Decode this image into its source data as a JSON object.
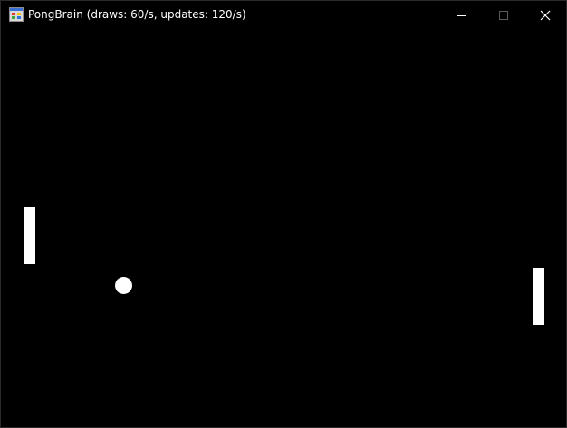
{
  "window": {
    "title": "PongBrain (draws: 60/s, updates: 120/s)",
    "app_icon": "application-icon",
    "controls": {
      "minimize_icon": "minimize-icon",
      "maximize_icon": "maximize-icon",
      "close_icon": "close-icon"
    }
  },
  "colors": {
    "background": "#000000",
    "foreground": "#ffffff",
    "disabled_control": "#5a5a5a"
  },
  "game": {
    "elements": [
      "left-paddle",
      "right-paddle",
      "ball"
    ]
  }
}
